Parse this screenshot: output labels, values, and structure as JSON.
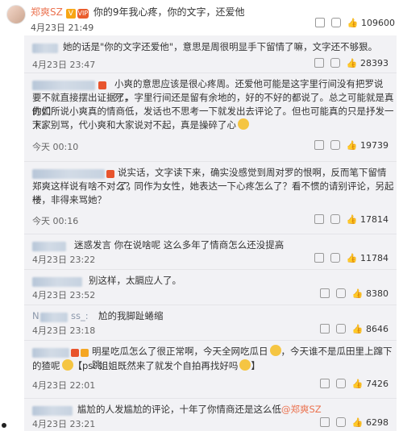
{
  "post": {
    "author": "郑爽SZ",
    "text": "你的9年我心疼，你的文字，还爱他",
    "time": "4月23日 21:49",
    "likes": "109600"
  },
  "comments": [
    {
      "text": "她的话是\"你的文字还爱他\"，意思是周很明显手下留情了嘛，文字还不够狠。",
      "time": "4月23日 23:47",
      "likes": "28393"
    },
    {
      "text_lines": [
        "小爽的意思应该是很心疼周。还爱他可能是这字里行间没有把罗说死，",
        "要不就直接摆出证据了，字里行间还是留有余地的，好的不好的都说了。总之可能就是真的如",
        "你们所说小爽真的情商低，发话也不思考一下就发出去评论了。但也可能真的只是抒发一下。",
        "大家别骂，代小爽和大家说对不起，真是操碎了心"
      ],
      "time": "今天 00:10",
      "likes": "19739"
    },
    {
      "text_lines": [
        "说实话，文字读下来，确实没感觉到周对罗的恨啊，反而笔下留情了，",
        "郑爽这样说有啥不对么？同作为女性，她表达一下心疼怎么了？看不惯的请别评论，另起一",
        "楼，非得来骂她？"
      ],
      "time": "今天 00:16",
      "likes": "17814"
    },
    {
      "text": "迷惑发言 你在说啥呢 这么多年了情商怎么还没提高",
      "time": "4月23日 23:22",
      "likes": "11784"
    },
    {
      "text": "别这样，太膈应人了。",
      "time": "4月23日 23:52",
      "likes": "8380"
    },
    {
      "user_partial_left": "N",
      "user_partial_right": "ss_:",
      "text": "尬的我脚趾蜷缩",
      "time": "4月23日 23:18",
      "likes": "8646"
    },
    {
      "text_lines": [
        "明星吃瓜怎么了很正常啊，今天全网吃瓜日",
        "，今天谁不是瓜田里上蹿下跳",
        "的猹呢",
        "【ps: 姐姐既然来了就发个自拍再找好吗"
      ],
      "time": "4月23日 22:01",
      "likes": "7426"
    },
    {
      "text": "尴尬的人发尴尬的评论，十年了你情商还是这么低",
      "mention": "@郑爽SZ",
      "time": "4月23日 23:21",
      "likes": "6298"
    }
  ]
}
